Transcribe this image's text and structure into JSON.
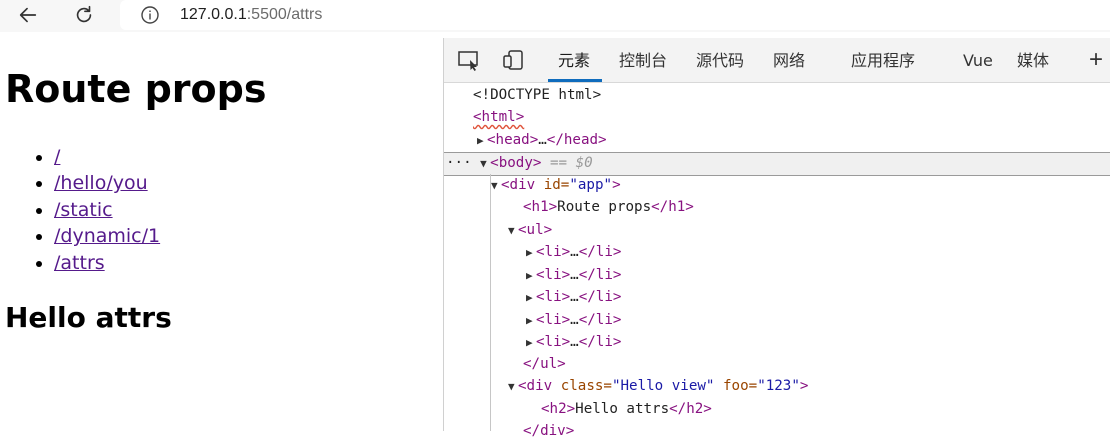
{
  "browser": {
    "url_host": "127.0.0.1",
    "url_rest": ":5500/attrs"
  },
  "page": {
    "title": "Route props",
    "links": [
      "/",
      "/hello/you",
      "/static",
      "/dynamic/1",
      "/attrs"
    ],
    "subtitle": "Hello attrs"
  },
  "devtools": {
    "tabs": [
      "元素",
      "控制台",
      "源代码",
      "网络",
      "应用程序",
      "Vue",
      "媒体"
    ],
    "active_tab": "元素",
    "dom": {
      "doctype": "<!DOCTYPE html>",
      "html_tag": "<html>",
      "head_open": "<head>",
      "ellipsis": "…",
      "head_close": "</head>",
      "body_tag": "<body>",
      "body_note": "== $0",
      "div_open": "<div ",
      "id_name": "id=",
      "id_value": "\"app\"",
      "gt": ">",
      "h1_open": "<h1>",
      "h1_text": "Route props",
      "h1_close": "</h1>",
      "ul_open": "<ul>",
      "li_open": "<li>",
      "li_close": "</li>",
      "ul_close": "</ul>",
      "class_name": "class=",
      "class_value": "\"Hello view\"",
      "foo_name": "foo=",
      "foo_value": "\"123\"",
      "h2_open": "<h2>",
      "h2_text": "Hello attrs",
      "h2_close": "</h2>",
      "div_close": "</div>",
      "dots": "···"
    }
  }
}
